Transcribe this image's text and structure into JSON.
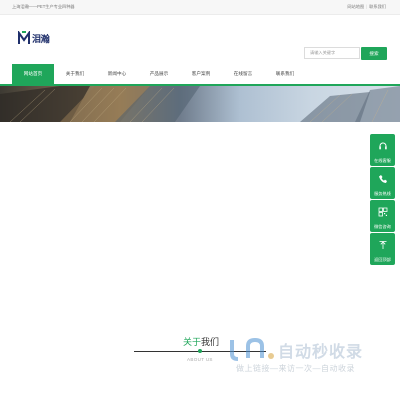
{
  "topbar": {
    "left_text": "上海泪瀚——PET生产专业四种器",
    "links": [
      "网站地图",
      "联系我们"
    ]
  },
  "logo": {
    "text": "泪瀚"
  },
  "search": {
    "placeholder": "请输入关键字",
    "button_label": "搜索"
  },
  "nav": {
    "items": [
      {
        "label": "网站首页"
      },
      {
        "label": "关于我们"
      },
      {
        "label": "新闻中心"
      },
      {
        "label": "产品展示"
      },
      {
        "label": "客户案例"
      },
      {
        "label": "在线留言"
      },
      {
        "label": "联系我们"
      }
    ],
    "active_index": 0
  },
  "float_bar": {
    "items": [
      {
        "label": "在线客服",
        "icon": "headset-icon"
      },
      {
        "label": "服务热线",
        "icon": "phone-icon"
      },
      {
        "label": "微信咨询",
        "icon": "qrcode-icon"
      },
      {
        "label": "返回顶部",
        "icon": "arrow-up-icon"
      }
    ]
  },
  "about": {
    "title_green": "关于",
    "title_dark": "我们",
    "subtitle": "ABOUT US"
  },
  "watermark": {
    "title": "自动秒收录",
    "subtitle": "做上链接—来访一次—自动收录"
  },
  "colors": {
    "brand": "#1fa65a",
    "logo": "#1f2f6b"
  }
}
